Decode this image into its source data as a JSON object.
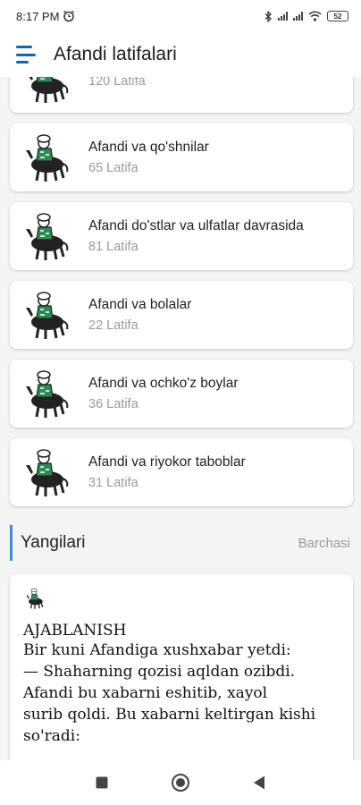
{
  "status_bar": {
    "time": "8:17 PM",
    "battery": "52"
  },
  "app_bar": {
    "title": "Afandi latifalari"
  },
  "categories": [
    {
      "title": "",
      "count": "120 Latifa"
    },
    {
      "title": "Afandi va qo'shnilar",
      "count": "65 Latifa"
    },
    {
      "title": "Afandi do'stlar va ulfatlar davrasida",
      "count": "81 Latifa"
    },
    {
      "title": "Afandi va bolalar",
      "count": "22 Latifa"
    },
    {
      "title": "Afandi va ochko'z boylar",
      "count": "36 Latifa"
    },
    {
      "title": "Afandi va riyokor taboblar",
      "count": "31 Latifa"
    }
  ],
  "section": {
    "title": "Yangilari",
    "link": "Barchasi"
  },
  "featured": {
    "title": "AJABLANISH",
    "body": "Bir kuni Afandiga xushxabar yetdi:\n— Shaharning qozisi aqldan ozibdi.\nAfandi bu xabarni eshitib, xayol\nsurib qoldi. Bu xabarni keltirgan kishi\nso'radi:"
  },
  "colors": {
    "accent": "#1565a8",
    "section_bar": "#3d8be6",
    "muted_text": "#9a9a9a"
  }
}
